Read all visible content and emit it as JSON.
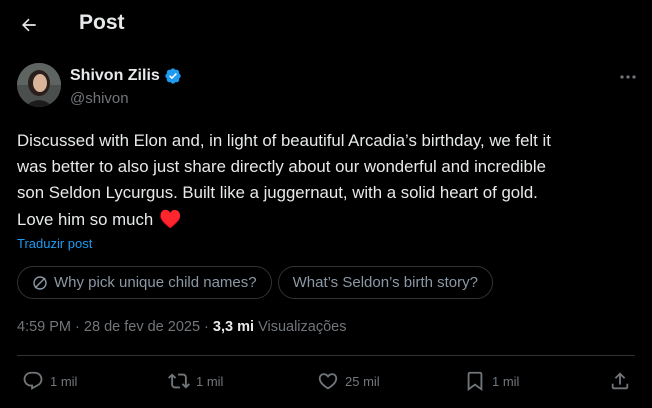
{
  "header": {
    "title": "Post"
  },
  "author": {
    "name": "Shivon Zilis",
    "handle": "@shivon"
  },
  "post": {
    "lines": [
      "Discussed with Elon and, in light of beautiful Arcadia’s birthday, we felt it",
      "was better to also just share directly about our wonderful and incredible",
      "son Seldon Lycurgus. Built like a juggernaut, with a solid heart of gold.",
      "Love him so much"
    ],
    "emoji": "♥️",
    "translate_label": "Traduzir post"
  },
  "chips": [
    {
      "label": "Why pick unique child names?"
    },
    {
      "label": "What’s Seldon’s birth story?"
    }
  ],
  "meta": {
    "time": "4:59 PM",
    "date": "28 de fev de 2025",
    "separator": "·",
    "views_count": "3,3 mi",
    "views_label": "Visualizações"
  },
  "actions": {
    "reply_count": "1 mil",
    "repost_count": "1 mil",
    "like_count": "25 mil",
    "bookmark_count": "1 mil"
  },
  "colors": {
    "background": "#000000",
    "text_primary": "#e7e9ea",
    "text_secondary": "#71767b",
    "link": "#1d9bf0",
    "verified": "#1d9bf0",
    "heart": "#f91880",
    "border": "#2f3336"
  },
  "icons": [
    "back-arrow-icon",
    "verified-badge-icon",
    "more-icon",
    "grok-icon",
    "reply-icon",
    "repost-icon",
    "like-icon",
    "bookmark-icon",
    "share-icon"
  ]
}
